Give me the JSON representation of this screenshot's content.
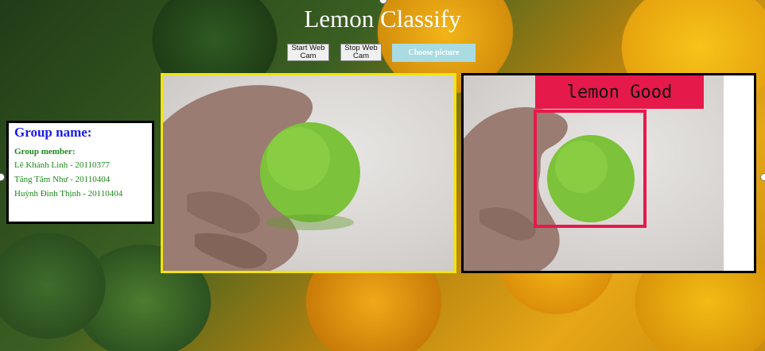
{
  "app": {
    "title": "Lemon Classify"
  },
  "controls": {
    "start_webcam": "Start Web\nCam",
    "stop_webcam": "Stop Web\nCam",
    "choose_picture": "Choose picture"
  },
  "group": {
    "title": "Group name:",
    "member_label": "Group member:",
    "members": [
      "Lê Khánh Linh - 20110377",
      "Tăng Tâm Như - 20110404",
      "Huỳnh Đình Thịnh - 20110404"
    ]
  },
  "detection": {
    "label": "lemon Good",
    "box_color": "#e6194b"
  },
  "colors": {
    "input_panel_border": "#f2e40c",
    "output_panel_border": "#000000",
    "choose_button_bg": "#a9dbe2",
    "group_title": "#1a1aee",
    "group_text": "#1a8a1a"
  }
}
